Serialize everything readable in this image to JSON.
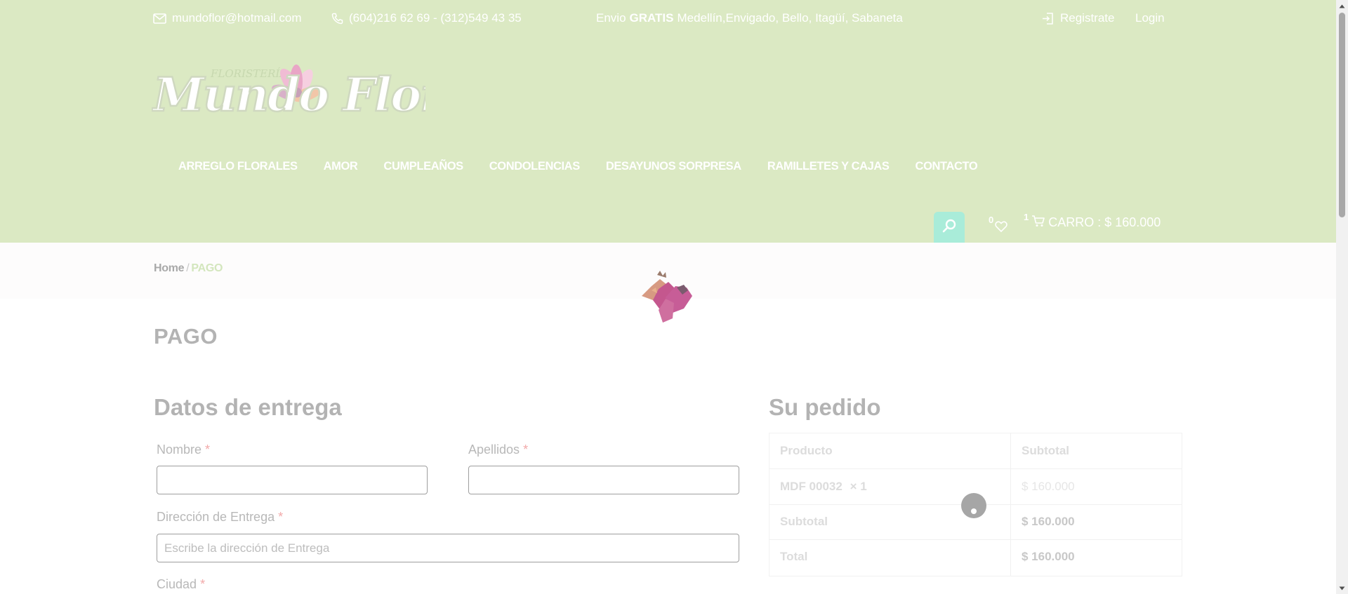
{
  "topbar": {
    "email": "mundoflor@hotmail.com",
    "phone": "(604)216 62 69 - (312)549 43 35",
    "shipping_prefix": "Envio",
    "shipping_highlight": "GRATIS",
    "shipping_rest": "Medellín,Envigado, Bello, Itagüí, Sabaneta",
    "register": "Registrate",
    "login": "Login"
  },
  "logo": {
    "small_text": "FLORISTERÍA",
    "brand": "Mundo Flor"
  },
  "nav": [
    {
      "label": "ARREGLO FLORALES"
    },
    {
      "label": "AMOR"
    },
    {
      "label": "CUMPLEAÑOS"
    },
    {
      "label": "CONDOLENCIAS"
    },
    {
      "label": "DESAYUNOS SORPRESA"
    },
    {
      "label": "RAMILLETES Y CAJAS"
    },
    {
      "label": "CONTACTO"
    }
  ],
  "header_actions": {
    "wishlist_count": "0",
    "cart_count": "1",
    "cart_label": "CARRO : $ 160.000"
  },
  "breadcrumb": {
    "home": "Home",
    "separator": "/",
    "current": "PAGO"
  },
  "page_title": "PAGO",
  "delivery": {
    "title": "Datos de entrega",
    "first_name_label": "Nombre",
    "last_name_label": "Apellidos",
    "address_label": "Dirección de Entrega",
    "address_placeholder": "Escribe la dirección de Entrega",
    "city_label": "Ciudad",
    "required_mark": "*"
  },
  "order": {
    "title": "Su pedido",
    "header_product": "Producto",
    "header_subtotal": "Subtotal",
    "item_name": "MDF 00032",
    "item_qty": "× 1",
    "item_price": "$ 160.000",
    "subtotal_label": "Subtotal",
    "subtotal_value": "$ 160.000",
    "total_label": "Total",
    "total_value": "$ 160.000"
  },
  "colors": {
    "header_bg": "#dbe9c3",
    "search_bg": "#a9ecd9",
    "breadcrumb_current": "#d3e6bd",
    "required": "#f2a9a9"
  }
}
